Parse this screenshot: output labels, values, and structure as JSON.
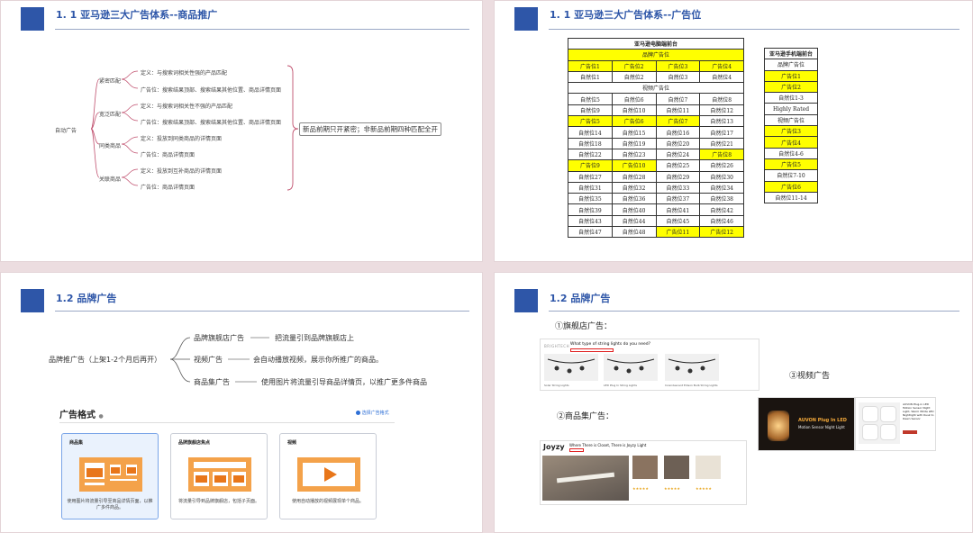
{
  "slides": {
    "s1": {
      "title": "1. 1 亚马逊三大广告体系--商品推广",
      "root": "自动广告",
      "branches": [
        {
          "label": "紧密匹配",
          "def": "定义：与搜索词相关性强的产品匹配",
          "pos": "广告位：搜索结果顶部、搜索结果其他位置、商品详情页面"
        },
        {
          "label": "宽泛匹配",
          "def": "定义：与搜索词相关性不强的产品匹配",
          "pos": "广告位：搜索结果顶部、搜索结果其他位置、商品详情页面"
        },
        {
          "label": "同类商品",
          "def": "定义：投放到同类商品的详情页面",
          "pos": "广告位：商品详情页面"
        },
        {
          "label": "关联商品",
          "def": "定义：投放到互补商品的详情页面",
          "pos": "广告位：商品详情页面"
        }
      ],
      "note": "新品前期只开紧密；非新品前期四种匹配全开"
    },
    "s2": {
      "title": "1. 1 亚马逊三大广告体系--广告位",
      "pc_title": "亚马逊电脑端前台",
      "pc_brand": "品牌广告位",
      "pc_video": "视频广告位",
      "pc_rows_top": [
        [
          [
            "广告位1",
            true
          ],
          [
            "广告位2",
            true
          ],
          [
            "广告位3",
            true
          ],
          [
            "广告位4",
            true
          ]
        ],
        [
          [
            "自然位1",
            false
          ],
          [
            "自然位2",
            false
          ],
          [
            "自然位3",
            false
          ],
          [
            "自然位4",
            false
          ]
        ]
      ],
      "pc_rows": [
        [
          [
            "自然位5",
            false
          ],
          [
            "自然位6",
            false
          ],
          [
            "自然位7",
            false
          ],
          [
            "自然位8",
            false
          ]
        ],
        [
          [
            "自然位9",
            false
          ],
          [
            "自然位10",
            false
          ],
          [
            "自然位11",
            false
          ],
          [
            "自然位12",
            false
          ]
        ],
        [
          [
            "广告位5",
            true
          ],
          [
            "广告位6",
            true
          ],
          [
            "广告位7",
            true
          ],
          [
            "自然位13",
            false
          ]
        ],
        [
          [
            "自然位14",
            false
          ],
          [
            "自然位15",
            false
          ],
          [
            "自然位16",
            false
          ],
          [
            "自然位17",
            false
          ]
        ],
        [
          [
            "自然位18",
            false
          ],
          [
            "自然位19",
            false
          ],
          [
            "自然位20",
            false
          ],
          [
            "自然位21",
            false
          ]
        ],
        [
          [
            "自然位22",
            false
          ],
          [
            "自然位23",
            false
          ],
          [
            "自然位24",
            false
          ],
          [
            "广告位8",
            true
          ]
        ],
        [
          [
            "广告位9",
            true
          ],
          [
            "广告位10",
            true
          ],
          [
            "自然位25",
            false
          ],
          [
            "自然位26",
            false
          ]
        ],
        [
          [
            "自然位27",
            false
          ],
          [
            "自然位28",
            false
          ],
          [
            "自然位29",
            false
          ],
          [
            "自然位30",
            false
          ]
        ],
        [
          [
            "自然位31",
            false
          ],
          [
            "自然位32",
            false
          ],
          [
            "自然位33",
            false
          ],
          [
            "自然位34",
            false
          ]
        ],
        [
          [
            "自然位35",
            false
          ],
          [
            "自然位36",
            false
          ],
          [
            "自然位37",
            false
          ],
          [
            "自然位38",
            false
          ]
        ],
        [
          [
            "自然位39",
            false
          ],
          [
            "自然位40",
            false
          ],
          [
            "自然位41",
            false
          ],
          [
            "自然位42",
            false
          ]
        ],
        [
          [
            "自然位43",
            false
          ],
          [
            "自然位44",
            false
          ],
          [
            "自然位45",
            false
          ],
          [
            "自然位46",
            false
          ]
        ],
        [
          [
            "自然位47",
            false
          ],
          [
            "自然位48",
            false
          ],
          [
            "广告位11",
            true
          ],
          [
            "广告位12",
            true
          ]
        ]
      ],
      "mobile_title": "亚马逊手机端前台",
      "mobile_rows": [
        [
          "品牌广告位",
          false
        ],
        [
          "广告位1",
          true
        ],
        [
          "广告位2",
          true
        ],
        [
          "自然位1-3",
          false
        ],
        [
          "Highly Rated",
          false
        ],
        [
          "视频广告位",
          false
        ],
        [
          "广告位3",
          true
        ],
        [
          "广告位4",
          true
        ],
        [
          "自然位4-6",
          false
        ],
        [
          "广告位5",
          true
        ],
        [
          "自然位7-10",
          false
        ],
        [
          "广告位6",
          true
        ],
        [
          "自然位11-14",
          false
        ]
      ]
    },
    "s3": {
      "title": "1.2 品牌广告",
      "root": "品牌推广告（上架1-2个月后再开）",
      "branches": [
        {
          "label": "品牌旗舰店广告",
          "desc": "把流量引到品牌旗舰店上"
        },
        {
          "label": "视频广告",
          "desc": "会自动播放视频，展示你所推广的商品。"
        },
        {
          "label": "商品集广告",
          "desc": "使用图片将流量引导商品详情页，以推广更多件商品"
        }
      ],
      "format_title": "广告格式",
      "format_link": "选择广告格式",
      "formats": [
        {
          "label": "商品集",
          "desc": "使用图片将流量引导至商品详情页面，以推广多件商品。"
        },
        {
          "label": "品牌旗舰店焦点",
          "desc": "将流量引导到品牌旗舰店，包括子页面。"
        },
        {
          "label": "视频",
          "desc": "使用自动播放的视频展现单个商品。"
        }
      ]
    },
    "s4": {
      "title": "1.2 品牌广告",
      "flagship": "①旗舰店广告：",
      "collection": "②商品集广告：",
      "video": "③视频广告",
      "shot1_brand": "BRIGHTECH",
      "shot1_headline": "What type of string lights do you need?",
      "shot1_items": [
        "Solar String Lights",
        "LED Plug In String Lights",
        "Incandescent Edison Bulb String Lights"
      ],
      "shot2_brand": "Joyzy",
      "shot2_headline": "Where There is Closet, There is Joyzy Light",
      "shot3_panel_title": "AUVON Plug In LED",
      "shot3_panel_sub": "Motion Sensor Night Light",
      "shot3_product": "AUVON Plug-in LED Motion Sensor Night Light, Warm White LED Nightlight with Dusk to Dawn Sensor"
    }
  },
  "colors": {
    "accent": "#2e56a8",
    "highlight": "#ffff00",
    "branch": "#c0506e"
  }
}
